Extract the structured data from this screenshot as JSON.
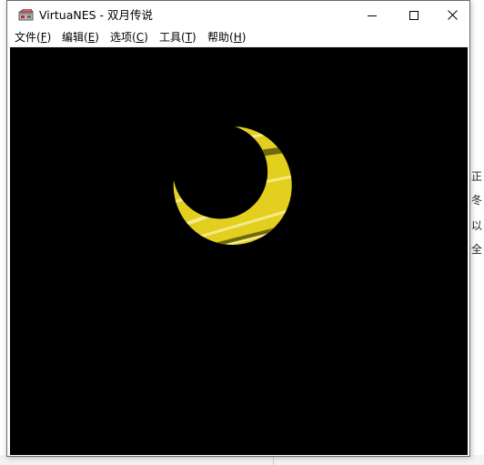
{
  "window": {
    "app_name": "VirtuaNES",
    "separator": " - ",
    "game_title": "双月传说",
    "title": "VirtuaNES - 双月传说"
  },
  "caption_buttons": {
    "minimize": "minimize-icon",
    "maximize": "maximize-icon",
    "close": "close-icon"
  },
  "menu": [
    {
      "label": "文件(",
      "mnemonic": "F",
      "end": ")"
    },
    {
      "label": "编辑(",
      "mnemonic": "E",
      "end": ")"
    },
    {
      "label": "选项(",
      "mnemonic": "C",
      "end": ")"
    },
    {
      "label": "工具(",
      "mnemonic": "T",
      "end": ")"
    },
    {
      "label": "帮助(",
      "mnemonic": "H",
      "end": ")"
    }
  ],
  "game": {
    "background": "#000000",
    "moon_color": "#e2cf1e",
    "moon_highlight": "#f5ea8a",
    "moon_shadow": "#6e6a0c"
  },
  "background_app": {
    "snippets": [
      "正",
      "冬",
      "以",
      "全"
    ]
  }
}
